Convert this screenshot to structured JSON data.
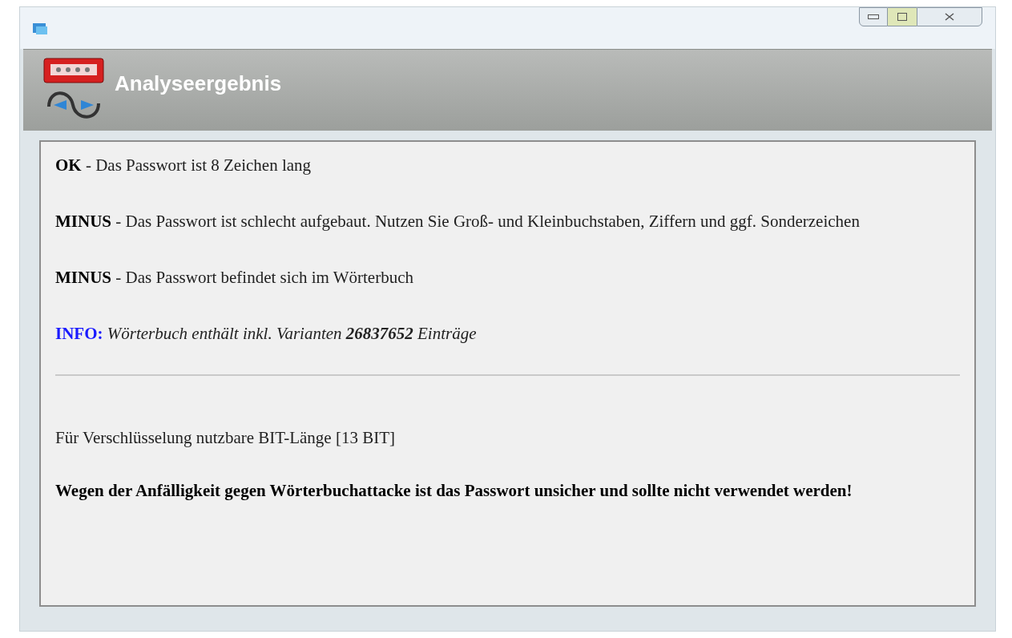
{
  "header": {
    "title": "Analyseergebnis"
  },
  "messages": [
    {
      "kind": "ok",
      "label": "OK",
      "text": "- Das Passwort ist 8 Zeichen lang"
    },
    {
      "kind": "minus",
      "label": "MINUS",
      "text": "- Das Passwort ist schlecht aufgebaut. Nutzen Sie Groß- und Kleinbuchstaben, Ziffern und ggf. Sonderzeichen"
    },
    {
      "kind": "minus",
      "label": "MINUS",
      "text": "- Das Passwort befindet sich im Wörterbuch"
    },
    {
      "kind": "info",
      "label": "INFO:",
      "text": "Wörterbuch enthält inkl. Varianten **26837652** Einträge"
    }
  ],
  "bit_length": "Für Verschlüsselung nutzbare BIT-Länge [13 BIT]",
  "verdict": "Wegen der Anfälligkeit gegen Wörterbuchattacke ist das Passwort unsicher und sollte nicht verwendet werden!"
}
